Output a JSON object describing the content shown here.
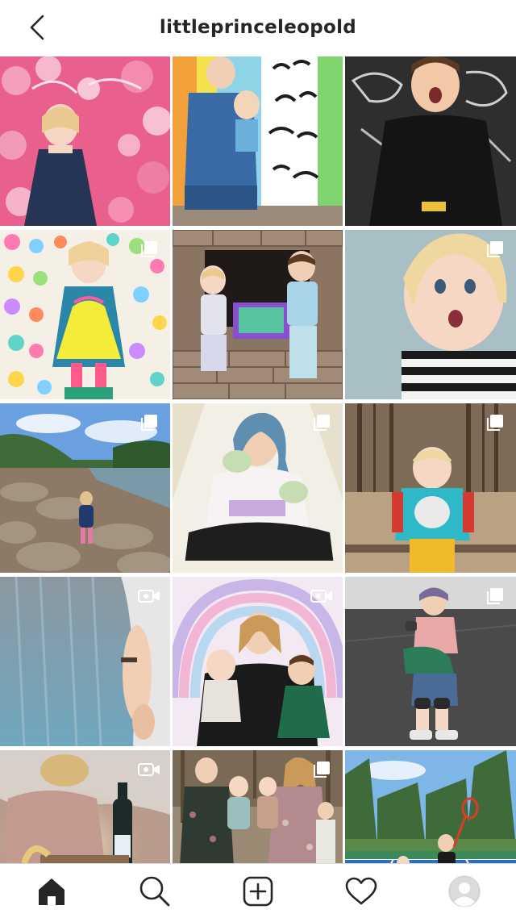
{
  "header": {
    "username": "littleprinceleopold"
  },
  "icons": {
    "back": "chevron-left-icon",
    "carousel": "multiple-posts-icon",
    "video": "video-camera-icon",
    "nav": [
      "home-icon",
      "search-icon",
      "new-post-icon",
      "heart-icon",
      "profile-avatar"
    ]
  },
  "grid": {
    "posts": [
      {
        "row": 1,
        "col": 1,
        "badge": "none",
        "scene": "toddler girl in navy dress in front of pink flower wall with neon sign"
      },
      {
        "row": 1,
        "col": 2,
        "badge": "none",
        "scene": "woman in denim overalls holding child in front of lettered wall"
      },
      {
        "row": 1,
        "col": 3,
        "badge": "none",
        "scene": "boy in black sweater against chalkboard wall"
      },
      {
        "row": 2,
        "col": 1,
        "badge": "carousel",
        "scene": "toddler in rainbow dress on colorful candy background"
      },
      {
        "row": 2,
        "col": 2,
        "badge": "none",
        "scene": "two kids sitting at stone fireplace with gifts"
      },
      {
        "row": 2,
        "col": 3,
        "badge": "carousel",
        "scene": "surprised blonde toddler in striped shirt"
      },
      {
        "row": 3,
        "col": 1,
        "badge": "carousel",
        "scene": "child walking on rocky river bank"
      },
      {
        "row": 3,
        "col": 2,
        "badge": "carousel",
        "scene": "woman with teal hair eating cake in teepee"
      },
      {
        "row": 3,
        "col": 3,
        "badge": "carousel",
        "scene": "toddler in bulldog sweater in forest"
      },
      {
        "row": 4,
        "col": 1,
        "badge": "video",
        "scene": "woman with ombre teal hair from behind"
      },
      {
        "row": 4,
        "col": 2,
        "badge": "video",
        "scene": "mother with two kids in front of pastel rainbow"
      },
      {
        "row": 4,
        "col": 3,
        "badge": "carousel",
        "scene": "roller skater woman on asphalt"
      },
      {
        "row": 5,
        "col": 1,
        "badge": "video",
        "scene": "woman opening glowing box with wine bottle"
      },
      {
        "row": 5,
        "col": 2,
        "badge": "carousel",
        "scene": "family portrait in floral dresses"
      },
      {
        "row": 5,
        "col": 3,
        "badge": "none",
        "scene": "kids playing tennis on blue court"
      }
    ]
  },
  "colors": {
    "text": "#262626",
    "border": "#dbdbdb",
    "background": "#ffffff"
  }
}
